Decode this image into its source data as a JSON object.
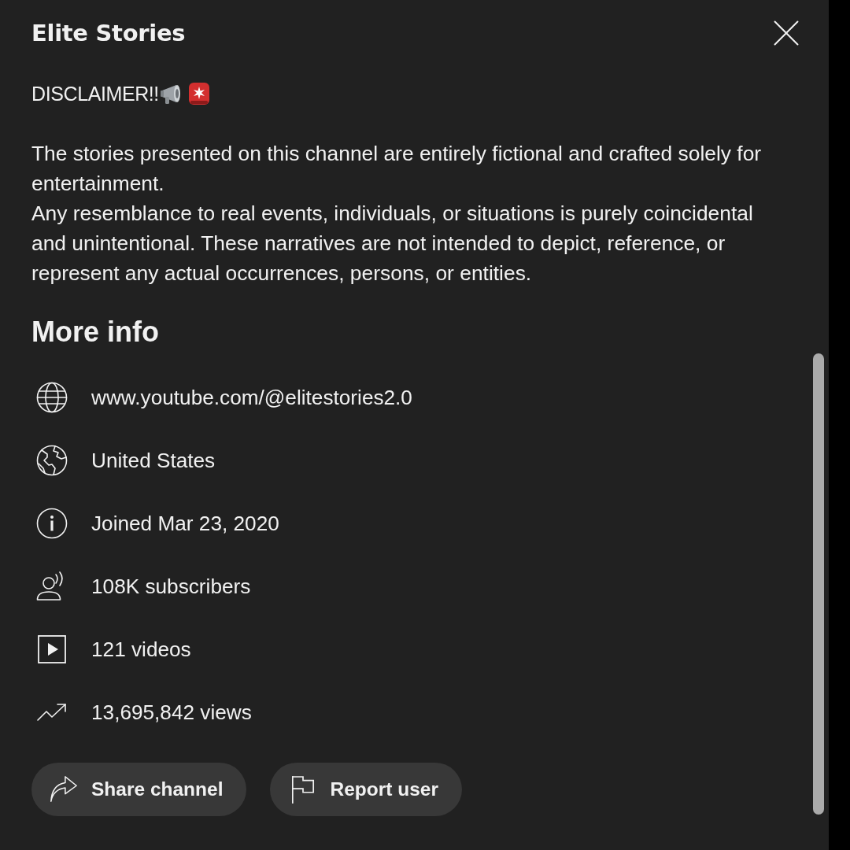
{
  "dialog": {
    "title": "Elite Stories"
  },
  "description": {
    "heading": "DISCLAIMER!!",
    "paragraphs": [
      "The stories presented on this channel are entirely fictional and crafted solely for entertainment.",
      "Any resemblance to real events, individuals, or situations is purely coincidental and unintentional. These narratives are not intended to depict, reference, or represent any actual occurrences, persons, or entities."
    ]
  },
  "more_info": {
    "title": "More info",
    "items": [
      {
        "kind": "link",
        "text": "www.youtube.com/@elitestories2.0"
      },
      {
        "kind": "location",
        "text": "United States"
      },
      {
        "kind": "joined",
        "text": "Joined Mar 23, 2020"
      },
      {
        "kind": "subscribers",
        "text": "108K subscribers"
      },
      {
        "kind": "videos",
        "text": "121 videos"
      },
      {
        "kind": "views",
        "text": "13,695,842 views"
      }
    ]
  },
  "buttons": [
    {
      "kind": "share",
      "label": "Share channel"
    },
    {
      "kind": "report",
      "label": "Report user"
    }
  ]
}
